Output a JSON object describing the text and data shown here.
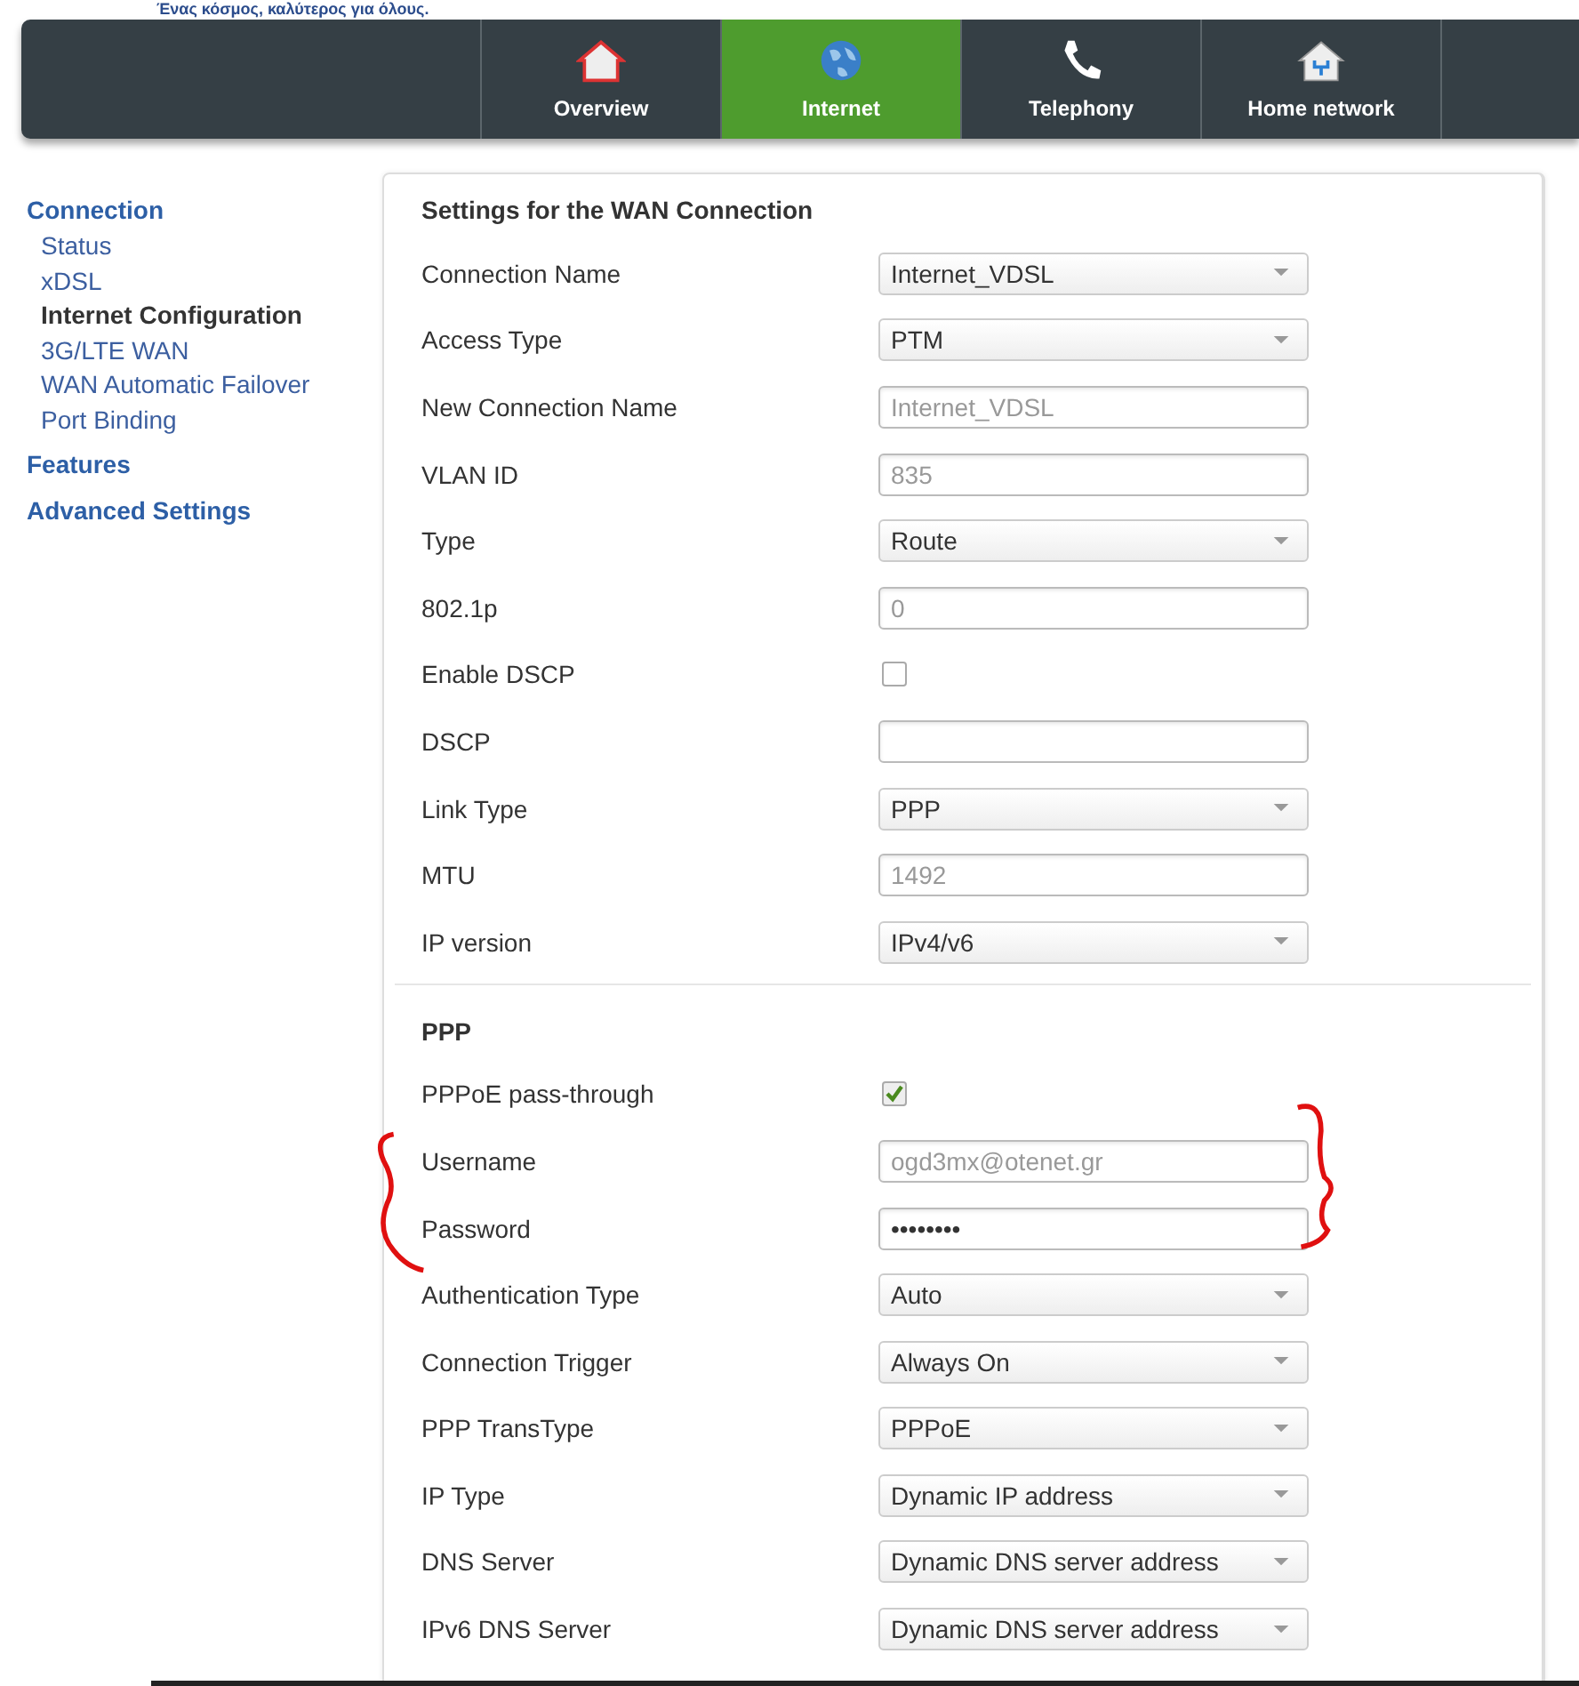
{
  "tagline": "Ένας κόσμος, καλύτερος για όλους.",
  "tabs": [
    {
      "label": "Overview",
      "selected": false
    },
    {
      "label": "Internet",
      "selected": true
    },
    {
      "label": "Telephony",
      "selected": false
    },
    {
      "label": "Home network",
      "selected": false
    }
  ],
  "sidebar": {
    "sections": [
      {
        "label": "Connection",
        "items": [
          {
            "label": "Status",
            "selected": false
          },
          {
            "label": "xDSL",
            "selected": false
          },
          {
            "label": "Internet Configuration",
            "selected": true
          },
          {
            "label": "3G/LTE WAN",
            "selected": false
          },
          {
            "label": "WAN Automatic Failover",
            "selected": false
          },
          {
            "label": "Port Binding",
            "selected": false
          }
        ]
      },
      {
        "label": "Features"
      },
      {
        "label": "Advanced Settings"
      }
    ]
  },
  "sections": [
    {
      "title": "Settings for the WAN Connection",
      "rows": [
        {
          "label": "Connection Name",
          "kind": "select",
          "value": "Internet_VDSL"
        },
        {
          "label": "Access Type",
          "kind": "select",
          "value": "PTM"
        },
        {
          "label": "New Connection Name",
          "kind": "input",
          "placeholder": "Internet_VDSL"
        },
        {
          "label": "VLAN ID",
          "kind": "input",
          "placeholder": "835"
        },
        {
          "label": "Type",
          "kind": "select",
          "value": "Route"
        },
        {
          "label": "802.1p",
          "kind": "input",
          "placeholder": "0"
        },
        {
          "label": "Enable DSCP",
          "kind": "checkbox",
          "checked": false
        },
        {
          "label": "DSCP",
          "kind": "input"
        },
        {
          "label": "Link Type",
          "kind": "select",
          "value": "PPP"
        },
        {
          "label": "MTU",
          "kind": "input",
          "placeholder": "1492"
        },
        {
          "label": "IP version",
          "kind": "select",
          "value": "IPv4/v6"
        }
      ]
    },
    {
      "title": "PPP",
      "rows": [
        {
          "label": "PPPoE pass-through",
          "kind": "checkbox",
          "checked": true
        },
        {
          "label": "Username",
          "kind": "input",
          "placeholder": "ogd3mx@otenet.gr"
        },
        {
          "label": "Password",
          "kind": "input",
          "value": "••••••••"
        },
        {
          "label": "Authentication Type",
          "kind": "select",
          "value": "Auto"
        },
        {
          "label": "Connection Trigger",
          "kind": "select",
          "value": "Always On"
        },
        {
          "label": "PPP TransType",
          "kind": "select",
          "value": "PPPoE"
        },
        {
          "label": "IP Type",
          "kind": "select",
          "value": "Dynamic IP address"
        },
        {
          "label": "DNS Server",
          "kind": "select",
          "value": "Dynamic DNS server address"
        },
        {
          "label": "IPv6 DNS Server",
          "kind": "select",
          "value": "Dynamic DNS server address"
        }
      ]
    }
  ]
}
